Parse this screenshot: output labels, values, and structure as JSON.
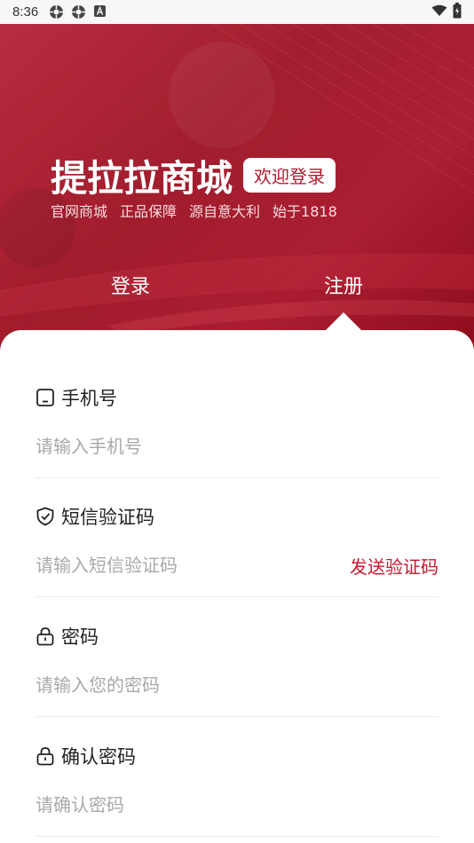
{
  "status_bar": {
    "time": "8:36",
    "icons": [
      "sync-icon",
      "sync-icon",
      "a-icon"
    ],
    "right_icons": [
      "wifi-icon",
      "battery-icon"
    ]
  },
  "banner": {
    "brand_title": "提拉拉商城",
    "welcome_badge": "欢迎登录",
    "tagline": [
      "官网商城",
      "正品保障",
      "源自意大利",
      "始于1818"
    ],
    "accent_color": "#b0152a"
  },
  "tabs": {
    "login": "登录",
    "register": "注册",
    "active": "register"
  },
  "form": {
    "phone": {
      "label": "手机号",
      "placeholder": "请输入手机号",
      "icon": "phone-icon"
    },
    "sms_code": {
      "label": "短信验证码",
      "placeholder": "请输入短信验证码",
      "send_label": "发送验证码",
      "icon": "shield-check-icon"
    },
    "password": {
      "label": "密码",
      "placeholder": "请输入您的密码",
      "icon": "lock-icon"
    },
    "confirm_password": {
      "label": "确认密码",
      "placeholder": "请确认密码",
      "icon": "lock-icon"
    }
  }
}
